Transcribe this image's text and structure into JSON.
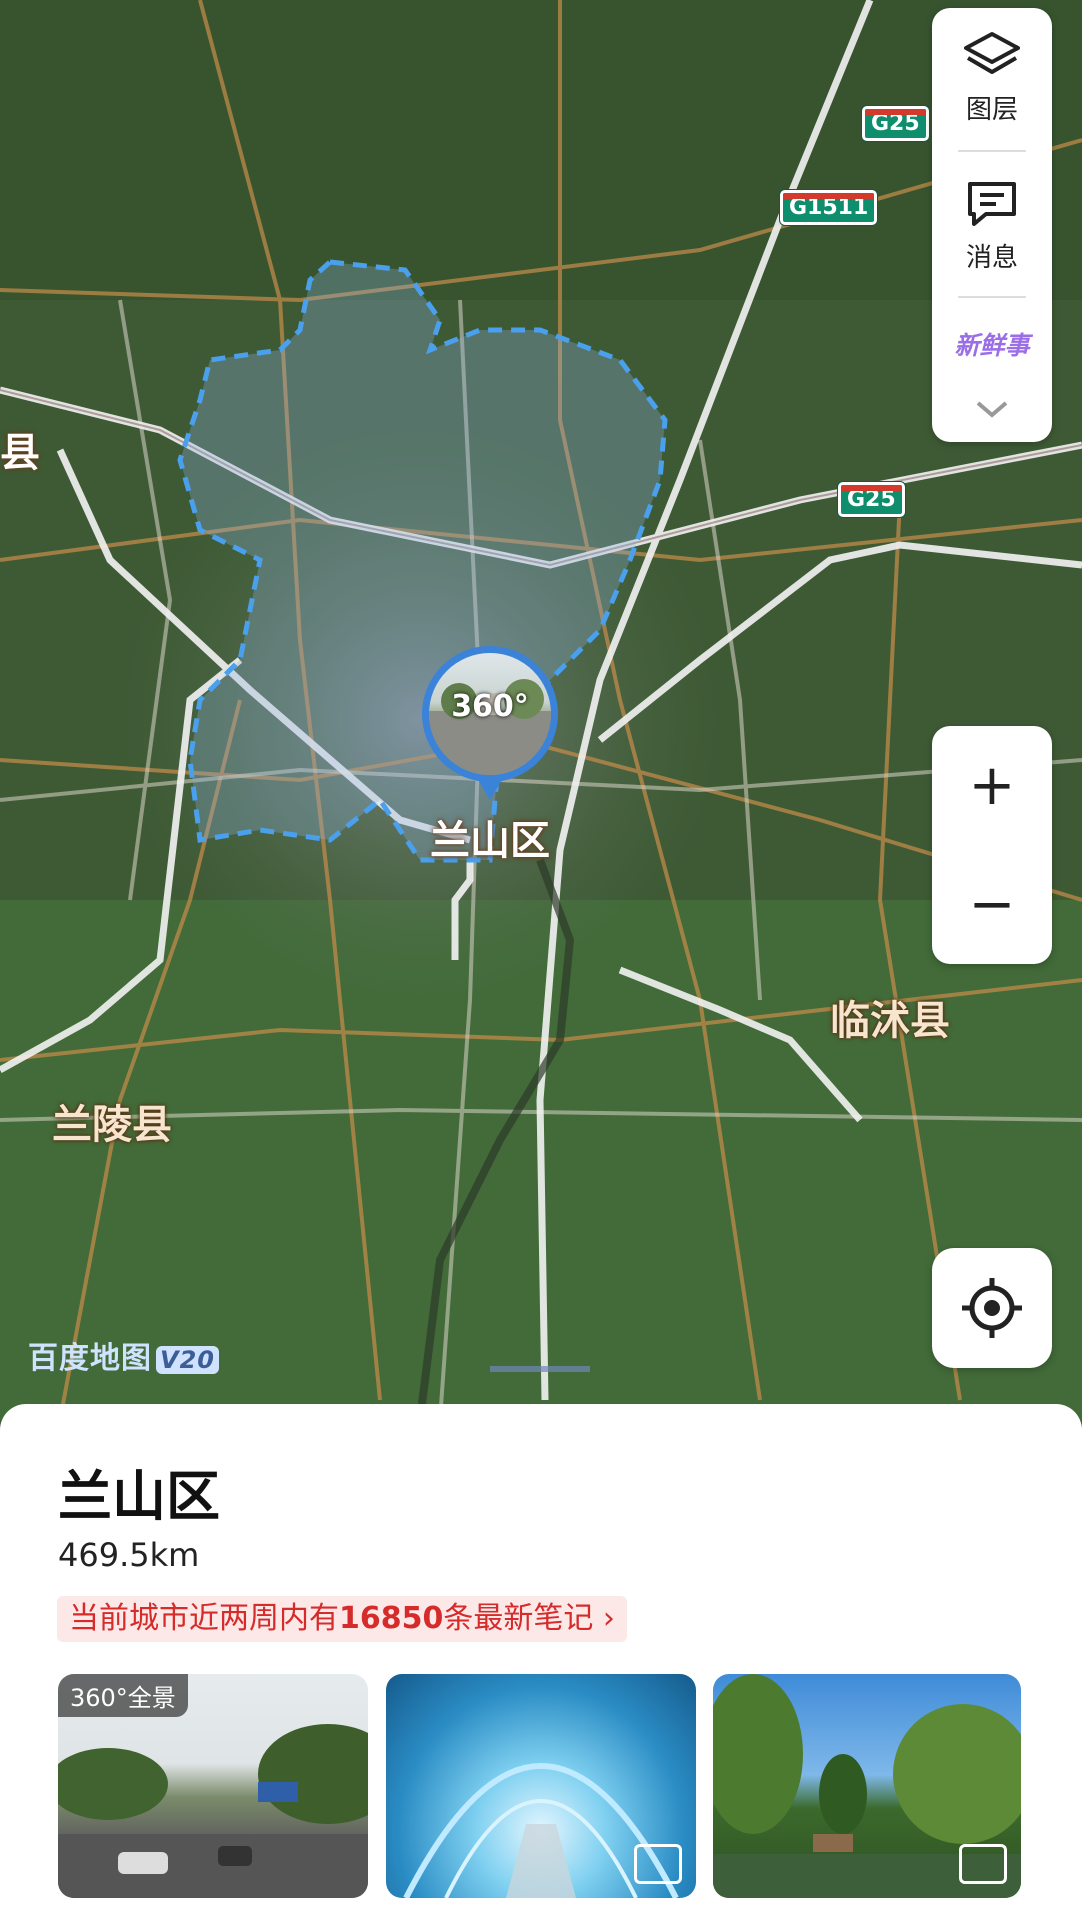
{
  "map": {
    "labels": {
      "current_district": "兰山区",
      "county_left_edge": "县",
      "county_east": "临沭县",
      "county_southwest": "兰陵县"
    },
    "highways": [
      "G25",
      "G1511",
      "G25"
    ],
    "watermark": {
      "brand": "百度地图",
      "version": "V20"
    },
    "pin": {
      "label": "360°"
    }
  },
  "layer_panel": {
    "layers_label": "图层",
    "messages_label": "消息",
    "fresh_label": "新鲜事"
  },
  "zoom": {
    "in": "+",
    "out": "−"
  },
  "sheet": {
    "title": "兰山区",
    "distance": "469.5km",
    "notes_prefix": "当前城市近两周内有",
    "notes_count": "16850",
    "notes_suffix": "条最新笔记",
    "notes_chevron": "›",
    "photos": [
      {
        "badge": "360°全景",
        "kind": "street"
      },
      {
        "kind": "aquarium"
      },
      {
        "kind": "park"
      }
    ]
  },
  "colors": {
    "accent_blue": "#3b82d9",
    "highway_green": "#0f8e6d",
    "notes_red": "#d52b2b"
  }
}
